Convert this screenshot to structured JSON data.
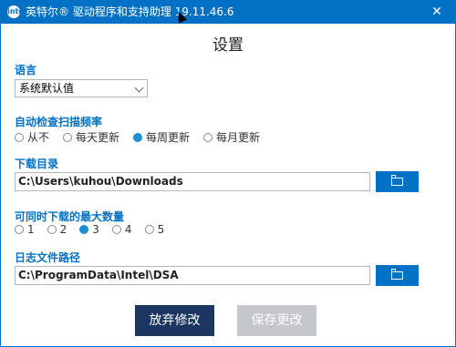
{
  "window": {
    "title": "英特尔® 驱动程序和支持助理 19.11.46.6",
    "icon_label": "intel",
    "close_glyph": "✕"
  },
  "heading": "设置",
  "language": {
    "label": "语言",
    "selected": "系统默认值"
  },
  "frequency": {
    "label": "自动检查扫描频率",
    "options": [
      "从不",
      "每天更新",
      "每周更新",
      "每月更新"
    ],
    "selected_index": 2
  },
  "download_dir": {
    "label": "下载目录",
    "value": "C:\\Users\\kuhou\\Downloads"
  },
  "max_downloads": {
    "label": "可同时下载的最大数量",
    "options": [
      "1",
      "2",
      "3",
      "4",
      "5"
    ],
    "selected_index": 2
  },
  "log_path": {
    "label": "日志文件路径",
    "value": "C:\\ProgramData\\Intel\\DSA"
  },
  "buttons": {
    "discard": "放弃修改",
    "save": "保存更改"
  },
  "colors": {
    "accent": "#0071c5",
    "radio_checked": "#1a8fd6",
    "discard_bg": "#1b3660",
    "save_disabled_bg": "#c4c7cc"
  }
}
